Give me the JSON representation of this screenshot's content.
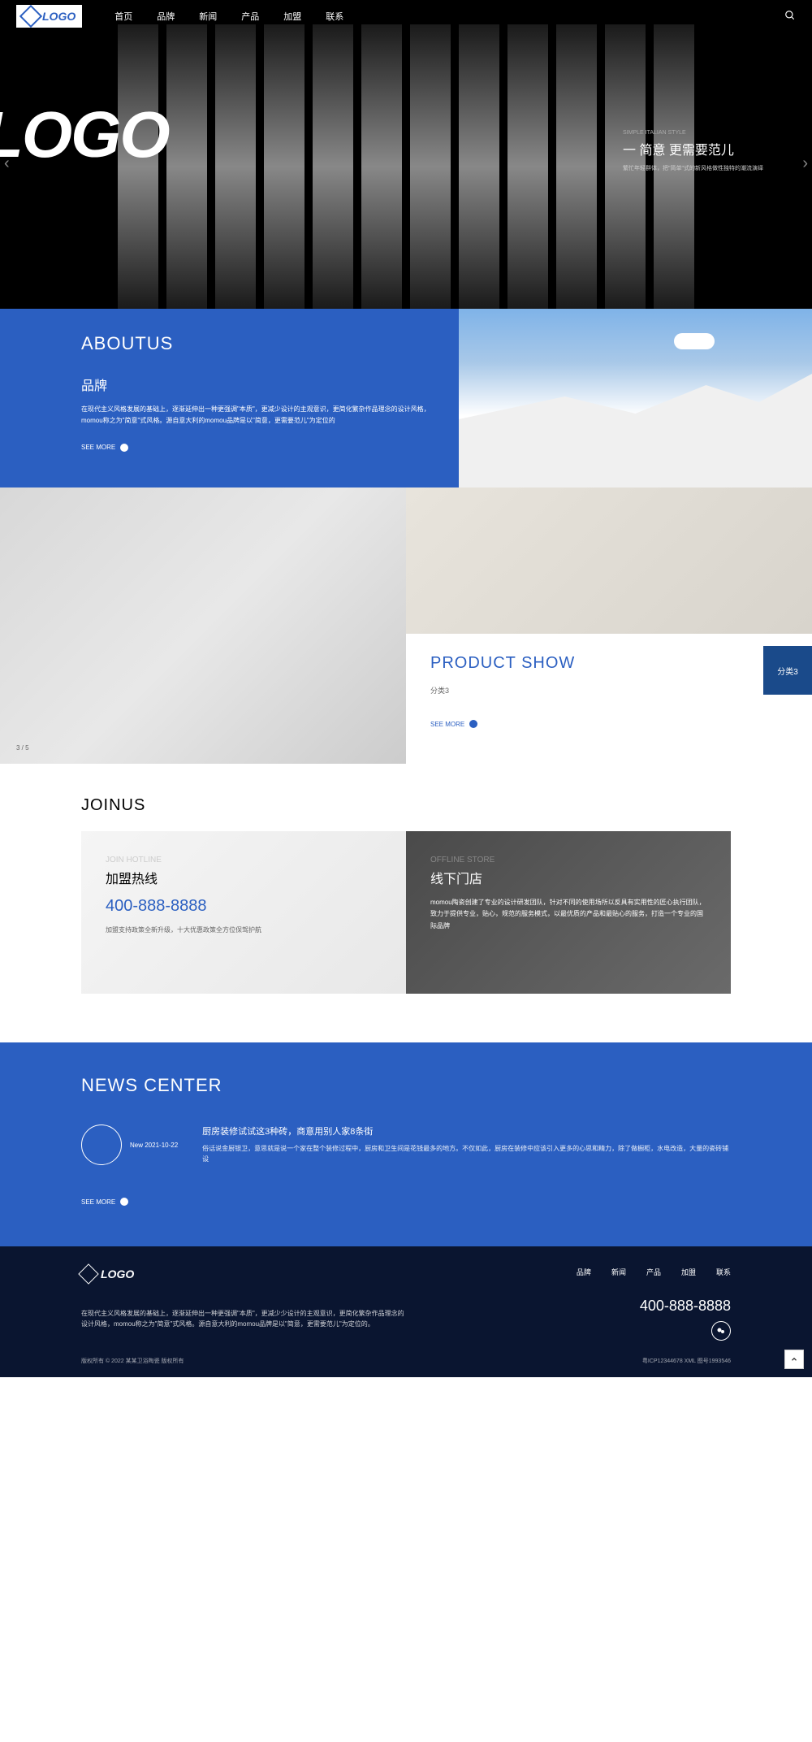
{
  "header": {
    "logo": "LOGO",
    "nav": [
      "首页",
      "品牌",
      "新闻",
      "产品",
      "加盟",
      "联系"
    ]
  },
  "hero": {
    "logo_text": "LOGO",
    "subtitle": "SIMPLE ITALIAN STYLE",
    "title": "一 简意  更需要范儿",
    "desc": "繁忙年轻群体，把\"简单\"式的新风格做性独特的潮流演绎"
  },
  "about": {
    "title": "ABOUTUS",
    "subtitle": "品牌",
    "desc": "在现代主义风格发展的基础上，逐渐延伸出一种更强调\"本质\"，更减少设计的主观意识，更简化繁杂作品理念的设计风格，momou称之为\"简意\"式风格。源自意大利的momou品牌是以\"简意，更需要范儿\"为定位的",
    "see_more": "SEE MORE"
  },
  "product": {
    "title": "PRODUCT SHOW",
    "category": "分类3",
    "badge": "分类3",
    "counter": "3 / 5",
    "see_more": "SEE MORE"
  },
  "join": {
    "title": "JOINUS",
    "left": {
      "ghost": "JOIN HOTLINE",
      "subtitle": "加盟热线",
      "phone": "400-888-8888",
      "desc": "加盟支持政策全新升级，十大优惠政策全方位保驾护航"
    },
    "right": {
      "ghost": "OFFLINE STORE",
      "subtitle": "线下门店",
      "desc": "momou陶瓷创建了专业的设计研发团队，针对不同的使用场所以反具有实用性的匠心执行团队，致力于提供专业，贴心，规范的服务模式，以最优质的产品和最贴心的服务，打造一个专业的国际品牌"
    }
  },
  "news": {
    "title": "NEWS CENTER",
    "date_label": "New 2021-10-22",
    "item_title": "厨房装修试试这3种砖，商意用别人家8条街",
    "item_desc": "俗话说金厨银卫，意思就是说一个家在整个装修过程中，厨房和卫生间是花钱最多的地方。不仅如此，厨房在装修中应该引入更多的心思和精力，除了做橱柜，水电改造，大量的瓷砖铺设",
    "see_more": "SEE MORE"
  },
  "footer": {
    "logo": "LOGO",
    "nav": [
      "品牌",
      "新闻",
      "产品",
      "加盟",
      "联系"
    ],
    "desc": "在现代主义风格发展的基础上，逐渐延伸出一种更强调\"本质\"，更减少少设计的主观意识，更简化繁杂作品理念的设计风格，momou称之为\"简意\"式风格。源自意大利的momou品牌是以\"简意，更需要范儿\"为定位的。",
    "phone": "400-888-8888",
    "copyright": "版权所有 © 2022 某某卫浴陶瓷 版权所有",
    "icp": "粤ICP12344678 XML 图号1993546"
  }
}
